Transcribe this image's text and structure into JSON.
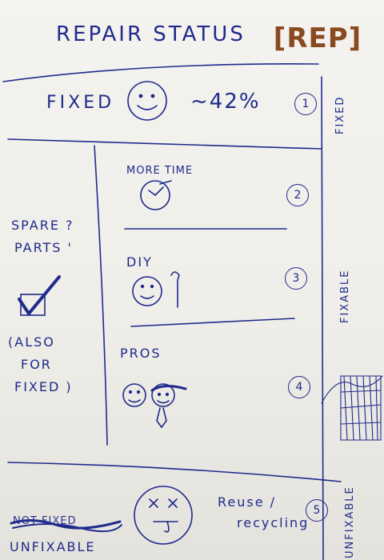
{
  "title": "REPAIR STATUS",
  "brand_logo": "[REP]",
  "fixed_section": {
    "label": "FIXED",
    "percent": "~42%",
    "number": "1",
    "side_label": "FIXED",
    "icon": "smiley-face-icon"
  },
  "fixable_section": {
    "side_label": "FIXABLE",
    "spare_parts_label": [
      "SPARE ?",
      "PARTS '"
    ],
    "note_lines": [
      "(ALSO",
      "FOR",
      "FIXED )"
    ],
    "check_icon": "checkbox-checked-icon",
    "options": [
      {
        "label": "MORE TIME",
        "number": "2",
        "icon": "clock-icon"
      },
      {
        "label": "DIY",
        "number": "3",
        "icon": "smiley-with-wrench-icon"
      },
      {
        "label": "PROS",
        "number": "4",
        "icon": "two-people-icon"
      }
    ]
  },
  "unfixable_section": {
    "side_label": "UNFIXABLE",
    "crossed_text": "NOT FIXED",
    "label": "UNFIXABLE",
    "note_lines": [
      "Reuse /",
      "recycling"
    ],
    "number": "5",
    "icon": "sad-face-icon"
  },
  "colors": {
    "ink": "#1f2a8c",
    "brand": "#8a4a1f",
    "paper": "#f2f1ed"
  }
}
